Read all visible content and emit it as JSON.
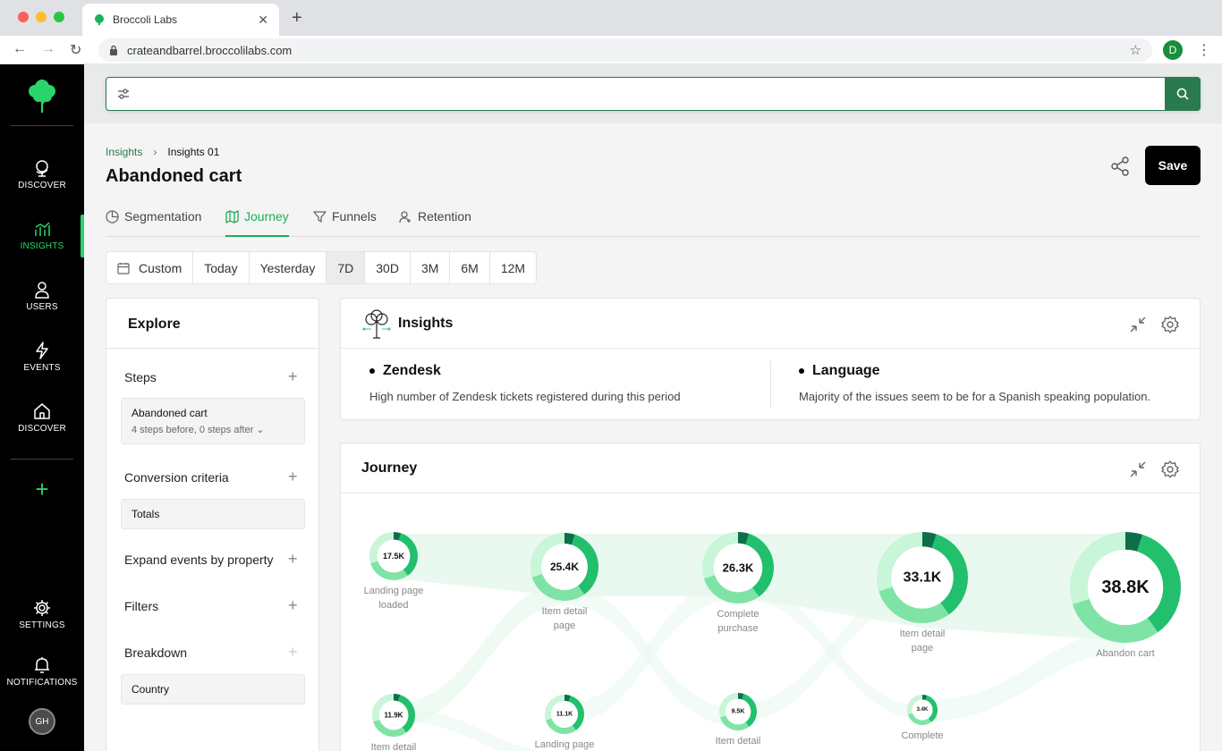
{
  "browser": {
    "tab_title": "Broccoli Labs",
    "url": "crateandbarrel.broccolilabs.com",
    "profile_initial": "D"
  },
  "sidebar": {
    "items": [
      {
        "label": "DISCOVER",
        "icon": "globe-icon"
      },
      {
        "label": "INSIGHTS",
        "icon": "insights-icon",
        "active": true
      },
      {
        "label": "USERS",
        "icon": "user-icon"
      },
      {
        "label": "EVENTS",
        "icon": "lightning-icon"
      },
      {
        "label": "DISCOVER",
        "icon": "home-icon"
      }
    ],
    "settings_label": "SETTINGS",
    "notifications_label": "NOTIFICATIONS",
    "avatar_initials": "GH",
    "accent": "#2bd46a"
  },
  "search": {
    "placeholder": "",
    "value": ""
  },
  "header": {
    "breadcrumb_root": "Insights",
    "breadcrumb_current": "Insights 01",
    "title": "Abandoned cart",
    "save_label": "Save"
  },
  "tabs": [
    {
      "label": "Segmentation",
      "icon": "pie-icon"
    },
    {
      "label": "Journey",
      "icon": "map-icon",
      "active": true
    },
    {
      "label": "Funnels",
      "icon": "funnel-icon"
    },
    {
      "label": "Retention",
      "icon": "retention-icon"
    }
  ],
  "date_range": {
    "options": [
      "Custom",
      "Today",
      "Yesterday",
      "7D",
      "30D",
      "3M",
      "6M",
      "12M"
    ],
    "selected": "7D"
  },
  "explore": {
    "title": "Explore",
    "steps_label": "Steps",
    "step_chip_title": "Abandoned cart",
    "step_chip_sub": "4 steps before, 0 steps after",
    "conversion_label": "Conversion criteria",
    "conversion_value": "Totals",
    "expand_label": "Expand events by property",
    "filters_label": "Filters",
    "breakdown_label": "Breakdown",
    "breakdown_value": "Country"
  },
  "insights": {
    "title": "Insights",
    "items": [
      {
        "heading": "Zendesk",
        "body": "High number of Zendesk tickets registered during this period"
      },
      {
        "heading": "Language",
        "body": "Majority of the issues seem to be for a Spanish speaking population."
      }
    ]
  },
  "journey": {
    "title": "Journey",
    "top_row": [
      {
        "value": "17.5K",
        "label_lines": [
          "Landing page",
          "loaded"
        ]
      },
      {
        "value": "25.4K",
        "label_lines": [
          "Item detail",
          "page"
        ]
      },
      {
        "value": "26.3K",
        "label_lines": [
          "Complete",
          "purchase"
        ]
      },
      {
        "value": "33.1K",
        "label_lines": [
          "Item detail",
          "page"
        ]
      },
      {
        "value": "38.8K",
        "label_lines": [
          "Abandon cart"
        ]
      }
    ],
    "bottom_row": [
      {
        "value": "11.9K",
        "label_lines": [
          "Item detail"
        ]
      },
      {
        "value": "11.1K",
        "label_lines": [
          "Landing page"
        ]
      },
      {
        "value": "9.5K",
        "label_lines": [
          "Item detail"
        ]
      },
      {
        "value": "3.4K",
        "label_lines": [
          "Complete"
        ]
      }
    ],
    "colors": {
      "dark": "#0f6e4a",
      "mid": "#22c06d",
      "light": "#7fe3a6",
      "pale": "#c9f5d8",
      "flow": "#e8f8ee"
    }
  }
}
